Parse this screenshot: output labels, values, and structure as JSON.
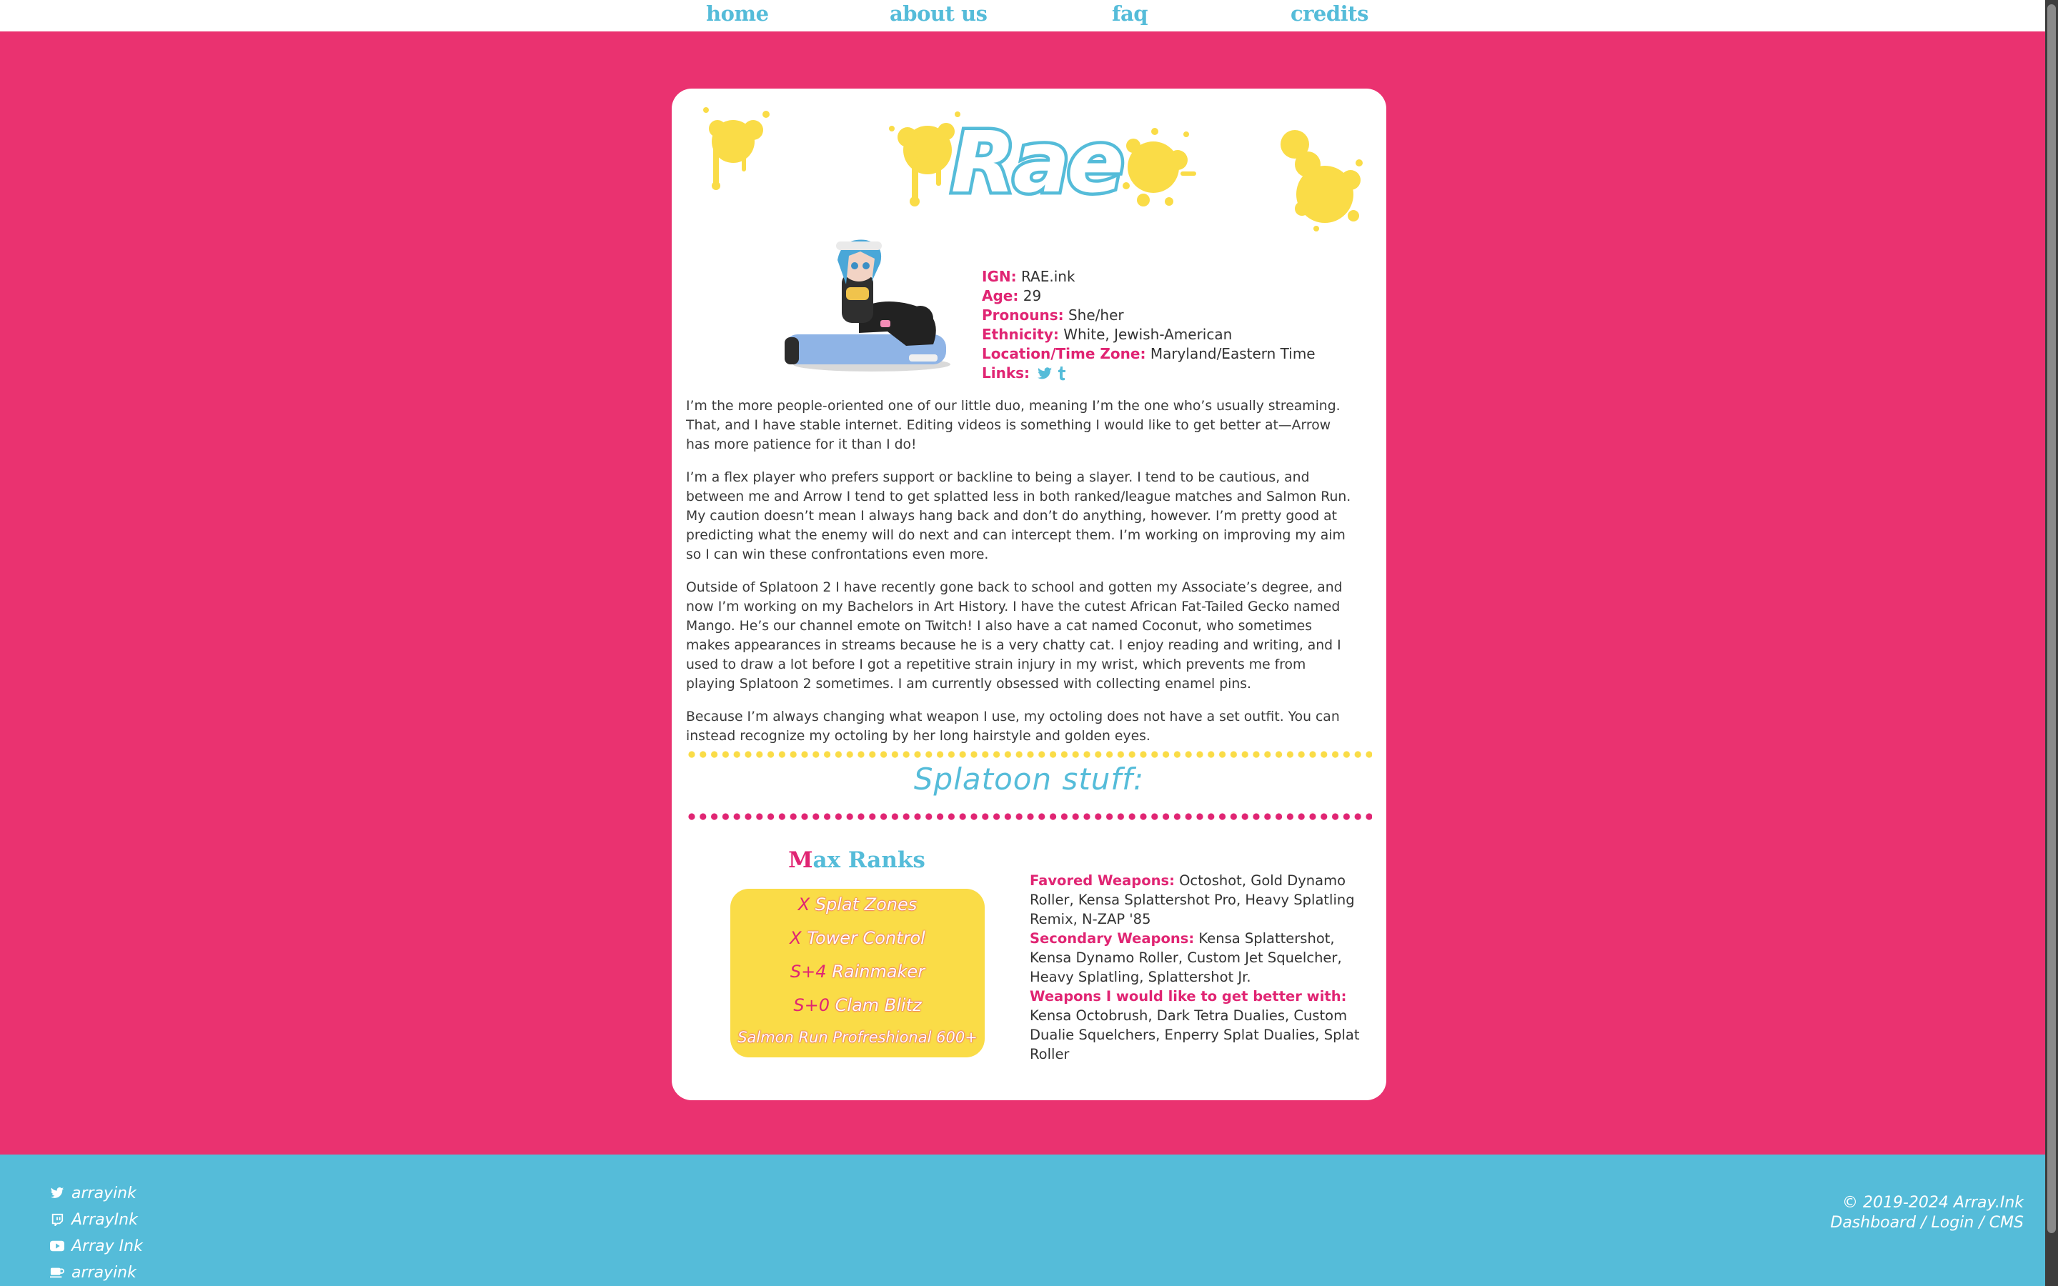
{
  "nav": {
    "home": "home",
    "about": "about us",
    "faq": "faq",
    "credits": "credits"
  },
  "profile": {
    "title": "Rae",
    "ign_label": "IGN:",
    "ign": "RAE.ink",
    "age_label": "Age:",
    "age": "29",
    "pronouns_label": "Pronouns:",
    "pronouns": "She/her",
    "ethnicity_label": "Ethnicity:",
    "ethnicity": "White, Jewish-American",
    "location_label": "Location/Time Zone:",
    "location": "Maryland/Eastern Time",
    "links_label": "Links:"
  },
  "bio": [
    "I’m the more people-oriented one of our little duo, meaning I’m the one who’s usually streaming. That, and I have stable internet. Editing videos is something I would like to get better at—Arrow has more patience for it than I do!",
    "I’m a flex player who prefers support or backline to being a slayer. I tend to be cautious, and between me and Arrow I tend to get splatted less in both ranked/league matches and Salmon Run. My caution doesn’t mean I always hang back and don’t do anything, however. I’m pretty good at predicting what the enemy will do next and can intercept them. I’m working on improving my aim so I can win these confrontations even more.",
    "Outside of Splatoon 2 I have recently gone back to school and gotten my Associate’s degree, and now I’m working on my Bachelors in Art History. I have the cutest African Fat-Tailed Gecko named Mango. He’s our channel emote on Twitch! I also have a cat named Coconut, who sometimes makes appearances in streams because he is a very chatty cat. I enjoy reading and writing, and I used to draw a lot before I got a repetitive strain injury in my wrist, which prevents me from playing Splatoon 2 sometimes. I am currently obsessed with collecting enamel pins.",
    "Because I’m always changing what weapon I use, my octoling does not have a set outfit. You can instead recognize my octoling by her long hairstyle and golden eyes."
  ],
  "splatoon": {
    "section_title": "Splatoon stuff:",
    "max_ranks_first": "M",
    "max_ranks_rest": "ax Ranks",
    "ranks": [
      {
        "rank": "X",
        "mode": "Splat Zones"
      },
      {
        "rank": "X",
        "mode": "Tower Control"
      },
      {
        "rank": "S+4",
        "mode": "Rainmaker"
      },
      {
        "rank": "S+0",
        "mode": "Clam Blitz"
      },
      {
        "rank": "",
        "mode": "Salmon Run Profreshional 600+"
      }
    ],
    "favored_label": "Favored Weapons:",
    "favored": "Octoshot, Gold Dynamo Roller, Kensa Splattershot Pro, Heavy Splatling Remix, N-ZAP '85",
    "secondary_label": "Secondary Weapons:",
    "secondary": "Kensa Splattershot, Kensa Dynamo Roller, Custom Jet Squelcher, Heavy Splatling, Splattershot Jr.",
    "better_label": "Weapons I would like to get better with:",
    "better": "Kensa Octobrush, Dark Tetra Dualies, Custom Dualie Squelchers, Enperry Splat Dualies, Splat Roller"
  },
  "footer": {
    "twitter": "arrayink",
    "twitch": "ArrayInk",
    "youtube": "Array Ink",
    "kofi": "arrayink",
    "copyright": "© 2019-2024 Array.Ink",
    "dashboard": "Dashboard",
    "login": "Login",
    "cms": "CMS",
    "sep": " / "
  },
  "colors": {
    "pink": "#ea3270",
    "accent_pink": "#e02573",
    "blue": "#55bcd9",
    "yellow": "#fadc47"
  }
}
